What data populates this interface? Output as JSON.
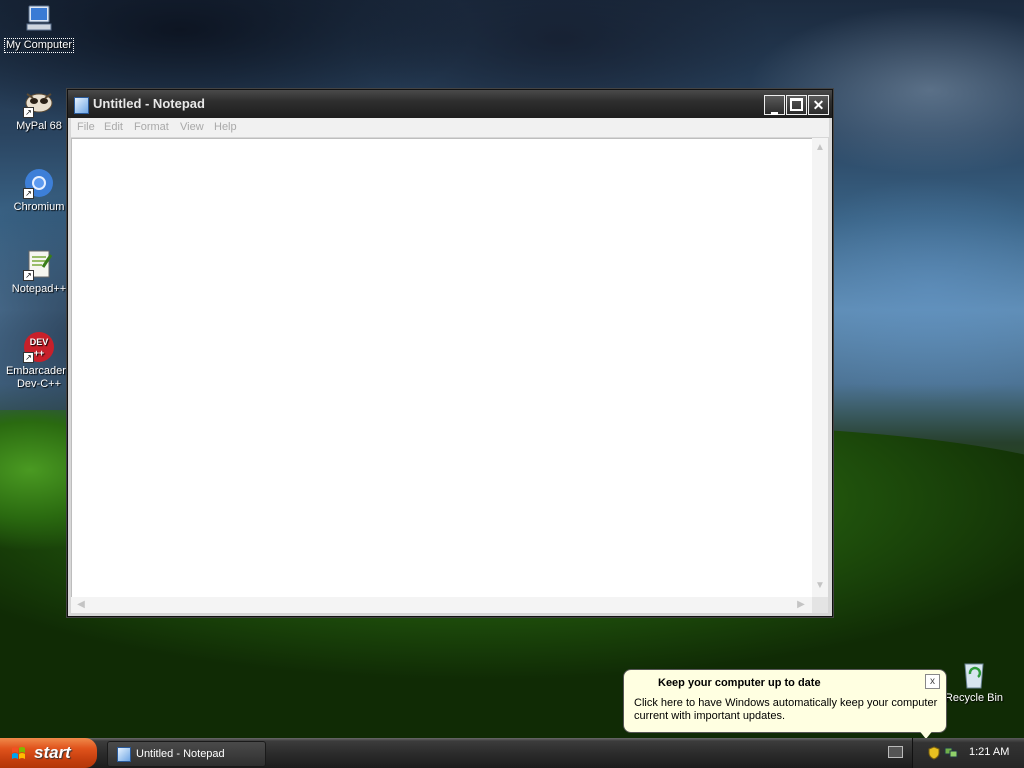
{
  "desktop": {
    "icons": [
      {
        "label": "My Computer"
      },
      {
        "label": "MyPal 68"
      },
      {
        "label": "Chromium"
      },
      {
        "label": "Notepad++"
      },
      {
        "label": "Embarcadero Dev-C++",
        "line1": "Embarcadero",
        "line2": "Dev-C++"
      },
      {
        "label": "Recycle Bin"
      }
    ]
  },
  "window": {
    "title": "Untitled - Notepad",
    "menu": [
      "File",
      "Edit",
      "Format",
      "View",
      "Help"
    ],
    "content": ""
  },
  "balloon": {
    "title": "Keep your computer up to date",
    "text": "Click here to have Windows automatically keep your computer current with important updates.",
    "close": "x"
  },
  "taskbar": {
    "start_label": "start",
    "task_label": "Untitled - Notepad",
    "clock": "1:21 AM"
  },
  "colors": {
    "start_button": "#e0531c",
    "balloon_bg": "#ffffe1",
    "menu_disabled": "#a9a9a9"
  }
}
